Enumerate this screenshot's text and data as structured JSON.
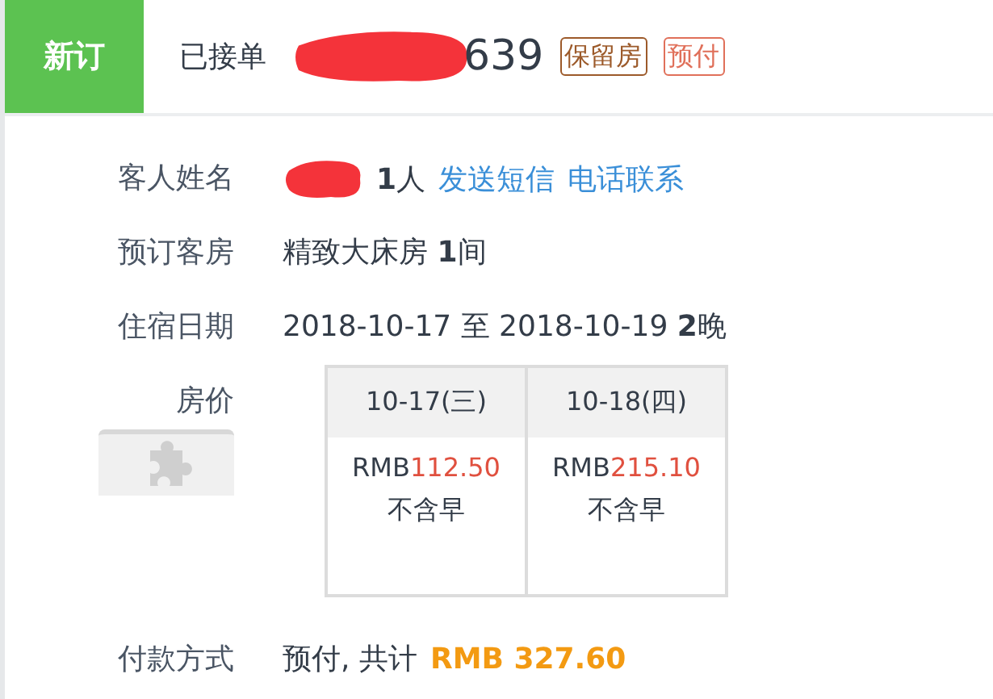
{
  "header": {
    "badge": "新订",
    "status": "已接单",
    "order_no": "639",
    "tags": [
      {
        "label": "保留房",
        "color": "#9c5a2a"
      },
      {
        "label": "预付",
        "color": "#e0705a"
      }
    ]
  },
  "details": [
    {
      "kind": "guest",
      "label": "客人姓名",
      "value": "**1**人",
      "links": [
        "发送短信",
        "电话联系"
      ]
    },
    {
      "kind": "text",
      "label": "预订客房",
      "value": "精致大床房 **1**间"
    },
    {
      "kind": "text",
      "label": "住宿日期",
      "value": "2018-10-17 至 2018-10-19 **2**晚"
    },
    {
      "kind": "price",
      "label": "房价",
      "columns": [
        {
          "date": "10-17(三)",
          "currency": "RMB",
          "amount": "112.50",
          "breakfast": "不含早"
        },
        {
          "date": "10-18(四)",
          "currency": "RMB",
          "amount": "215.10",
          "breakfast": "不含早"
        }
      ]
    },
    {
      "kind": "payment",
      "label": "付款方式",
      "value": "预付, 共计",
      "total": "RMB 327.60"
    }
  ]
}
